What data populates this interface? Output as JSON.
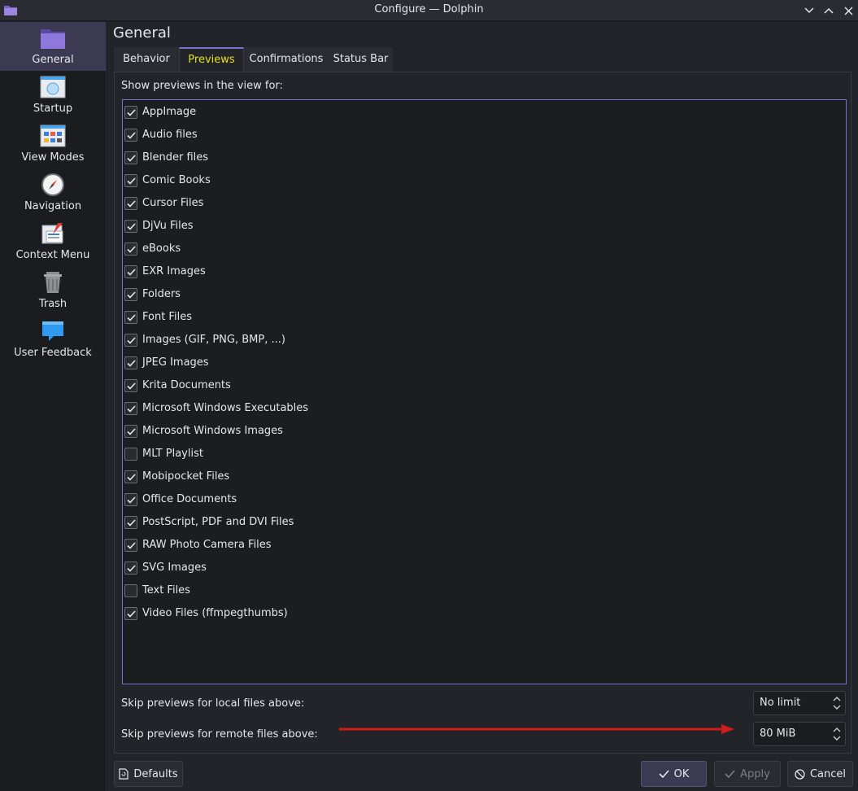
{
  "window": {
    "title": "Configure — Dolphin"
  },
  "sidebar": {
    "items": [
      {
        "label": "General",
        "icon": "folder-icon",
        "active": true
      },
      {
        "label": "Startup",
        "icon": "startup-window-icon",
        "active": false
      },
      {
        "label": "View Modes",
        "icon": "view-modes-icon",
        "active": false
      },
      {
        "label": "Navigation",
        "icon": "compass-icon",
        "active": false
      },
      {
        "label": "Context Menu",
        "icon": "context-menu-icon",
        "active": false
      },
      {
        "label": "Trash",
        "icon": "trash-icon",
        "active": false
      },
      {
        "label": "User Feedback",
        "icon": "feedback-bubble-icon",
        "active": false
      }
    ]
  },
  "page": {
    "title": "General",
    "tabs": [
      {
        "label": "Behavior",
        "active": false
      },
      {
        "label": "Previews",
        "active": true
      },
      {
        "label": "Confirmations",
        "active": false
      },
      {
        "label": "Status Bar",
        "active": false
      }
    ],
    "section_label": "Show previews in the view for:",
    "preview_items": [
      {
        "label": "AppImage",
        "checked": true
      },
      {
        "label": "Audio files",
        "checked": true
      },
      {
        "label": "Blender files",
        "checked": true
      },
      {
        "label": "Comic Books",
        "checked": true
      },
      {
        "label": "Cursor Files",
        "checked": true
      },
      {
        "label": "DjVu Files",
        "checked": true
      },
      {
        "label": "eBooks",
        "checked": true
      },
      {
        "label": "EXR Images",
        "checked": true
      },
      {
        "label": "Folders",
        "checked": true
      },
      {
        "label": "Font Files",
        "checked": true
      },
      {
        "label": "Images (GIF, PNG, BMP, ...)",
        "checked": true
      },
      {
        "label": "JPEG Images",
        "checked": true
      },
      {
        "label": "Krita Documents",
        "checked": true
      },
      {
        "label": "Microsoft Windows Executables",
        "checked": true
      },
      {
        "label": "Microsoft Windows Images",
        "checked": true
      },
      {
        "label": "MLT Playlist",
        "checked": false
      },
      {
        "label": "Mobipocket Files",
        "checked": true
      },
      {
        "label": "Office Documents",
        "checked": true
      },
      {
        "label": "PostScript, PDF and DVI Files",
        "checked": true
      },
      {
        "label": "RAW Photo Camera Files",
        "checked": true
      },
      {
        "label": "SVG Images",
        "checked": true
      },
      {
        "label": "Text Files",
        "checked": false
      },
      {
        "label": "Video Files (ffmpegthumbs)",
        "checked": true
      }
    ],
    "skip_local": {
      "label": "Skip previews for local files above:",
      "value": "No limit"
    },
    "skip_remote": {
      "label": "Skip previews for remote files above:",
      "value": "80 MiB"
    }
  },
  "buttons": {
    "defaults": "Defaults",
    "ok": "OK",
    "apply": "Apply",
    "cancel": "Cancel"
  },
  "colors": {
    "accent": "#7a6fd1",
    "active_tab_text": "#e5e017",
    "annotation_arrow": "#d11a1a"
  }
}
